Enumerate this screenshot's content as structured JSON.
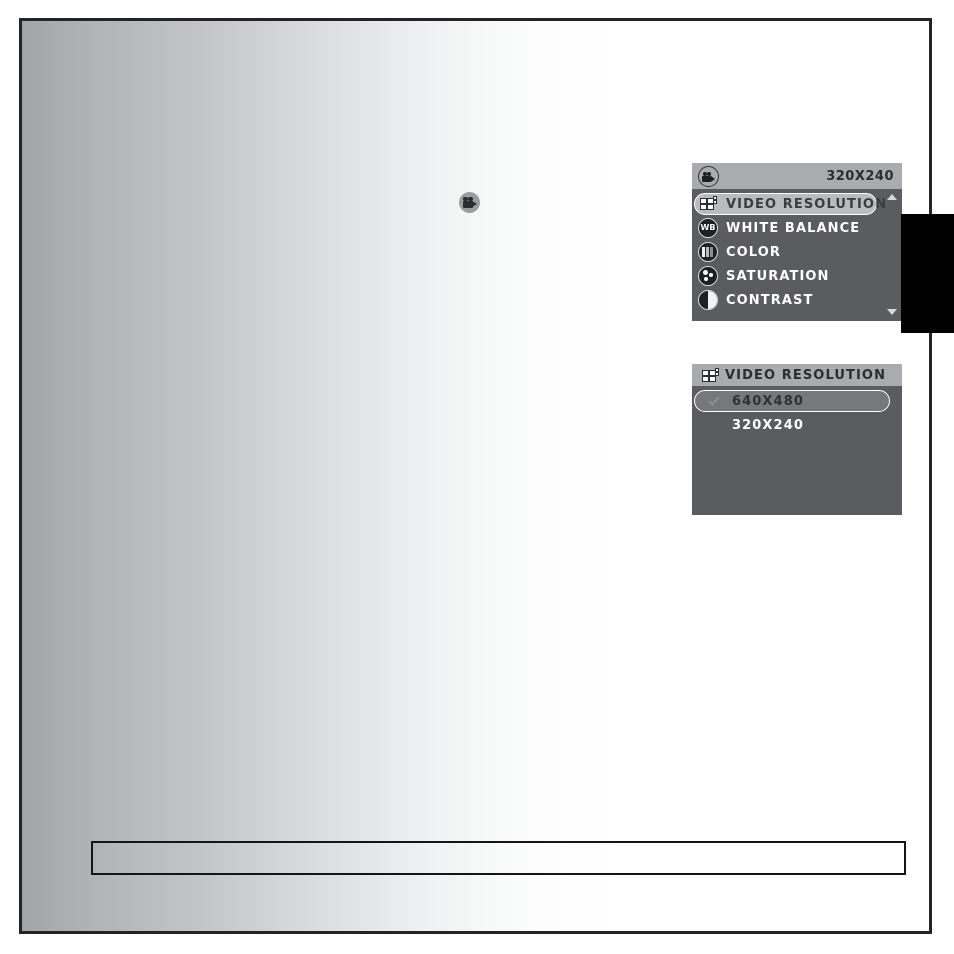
{
  "page": {
    "background_gradient_from": "#a2a5a8",
    "background_gradient_to": "#ffffff",
    "border_color": "#242426",
    "edge_tab_color": "#000000"
  },
  "inline_icon": {
    "name": "video-camera-icon",
    "tint": "#9a9da0"
  },
  "caption_box": {
    "text": ""
  },
  "main_menu": {
    "titlebar": {
      "icon": "video-camera-badge-icon",
      "value": "320X240"
    },
    "items": [
      {
        "icon": "grid-icon",
        "label": "VIDEO RESOLUTION",
        "selected": true
      },
      {
        "icon": "wb-icon",
        "label": "WHITE BALANCE",
        "selected": false
      },
      {
        "icon": "color-bars-icon",
        "label": "COLOR",
        "selected": false
      },
      {
        "icon": "saturation-icon",
        "label": "SATURATION",
        "selected": false
      },
      {
        "icon": "contrast-icon",
        "label": "CONTRAST",
        "selected": false
      }
    ],
    "scroll_up_arrow": "▲",
    "scroll_down_arrow": "▼",
    "panel_color": "#5b5c5f",
    "titlebar_color": "#a9abae",
    "highlight_color": "#b9bbbe"
  },
  "submenu": {
    "titlebar": {
      "icon": "grid-icon",
      "label": "VIDEO RESOLUTION"
    },
    "options": [
      {
        "label": "640X480",
        "checked": true
      },
      {
        "label": "320X240",
        "checked": false
      }
    ],
    "panel_color": "#5b5c5f",
    "titlebar_color": "#a9abae",
    "highlight_color": "#76787b"
  }
}
